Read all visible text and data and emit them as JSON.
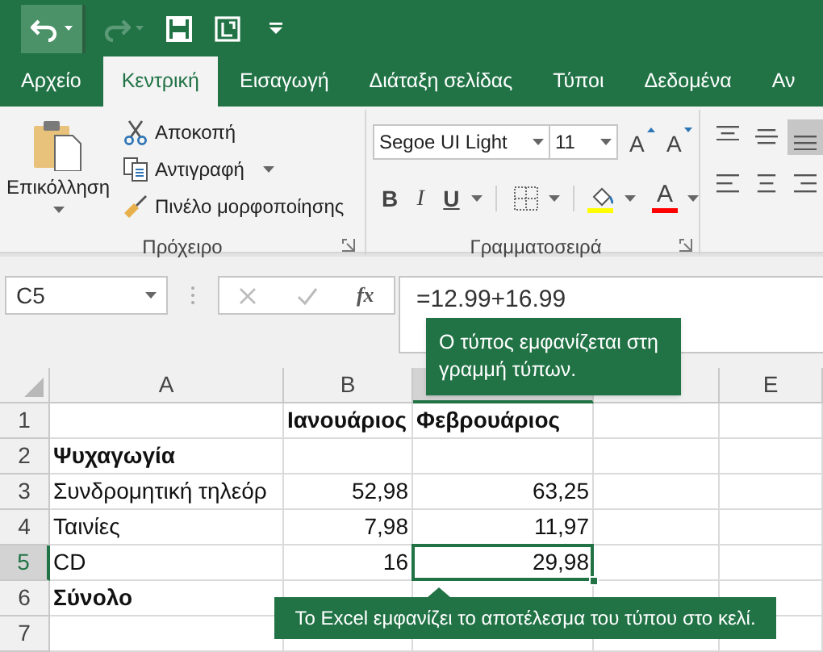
{
  "quick_access": [
    {
      "kind": "undo",
      "highlighted": true,
      "disabled": false
    },
    {
      "kind": "redo",
      "highlighted": false,
      "disabled": true
    },
    {
      "kind": "save",
      "highlighted": false,
      "disabled": false
    },
    {
      "kind": "touch",
      "highlighted": false,
      "disabled": false
    },
    {
      "kind": "customize",
      "highlighted": false,
      "disabled": false
    }
  ],
  "tabs": [
    {
      "label": "Αρχείο",
      "selected": false
    },
    {
      "label": "Κεντρική",
      "selected": true
    },
    {
      "label": "Εισαγωγή",
      "selected": false
    },
    {
      "label": "Διάταξη σελίδας",
      "selected": false
    },
    {
      "label": "Τύποι",
      "selected": false
    },
    {
      "label": "Δεδομένα",
      "selected": false
    },
    {
      "label": "Αν",
      "selected": false
    }
  ],
  "clipboard": {
    "paste": "Επικόλληση",
    "cut": "Αποκοπή",
    "copy": "Αντιγραφή",
    "format_painter": "Πινέλο μορφοποίησης",
    "label": "Πρόχειρο"
  },
  "font": {
    "font_name": "Segoe UI Light",
    "font_size": "11",
    "grow": "A",
    "shrink": "A",
    "bold": "B",
    "italic": "I",
    "underline": "U",
    "font_color": "A",
    "label": "Γραμματοσειρά"
  },
  "alignment": [
    {
      "kind": "top",
      "selected": false
    },
    {
      "kind": "middle",
      "selected": false
    },
    {
      "kind": "bottom",
      "selected": true
    },
    {
      "kind": "left",
      "selected": false
    },
    {
      "kind": "center",
      "selected": false
    },
    {
      "kind": "right",
      "selected": false
    }
  ],
  "formula_bar": {
    "name_box": "C5",
    "function_label": "fx",
    "formula": "=12.99+16.99"
  },
  "formula_tooltip": "Ο τύπος εμφανίζεται στη γραμμή τύπων.",
  "columns": [
    {
      "label": "A",
      "selected": false
    },
    {
      "label": "B",
      "selected": false
    },
    {
      "selected": true
    },
    {
      "selected": false
    },
    {
      "label": "E",
      "selected": false
    }
  ],
  "rows": [
    {
      "number": "1",
      "selected": false,
      "kind": "header",
      "cells": [
        null,
        "Ιανουάριος",
        "Φεβρουάριος"
      ]
    },
    {
      "number": "2",
      "selected": false,
      "kind": "category",
      "cells": [
        "Ψυχαγωγία"
      ]
    },
    {
      "number": "3",
      "selected": false,
      "kind": "data",
      "cells": [
        "Συνδρομητική τηλεόρ",
        "52,98",
        "63,25"
      ]
    },
    {
      "number": "4",
      "selected": false,
      "kind": "data",
      "cells": [
        "Ταινίες",
        "7,98",
        "11,97"
      ]
    },
    {
      "number": "5",
      "selected": true,
      "kind": "data",
      "cells": [
        "CD",
        "16",
        "29,98"
      ]
    },
    {
      "number": "6",
      "selected": false,
      "kind": "category",
      "cells": [
        "Σύνολο"
      ]
    },
    {
      "number": "7",
      "selected": false,
      "kind": "data"
    }
  ],
  "result_tooltip": "Το Excel εμφανίζει το αποτέλεσμα του τύπου στο κελί."
}
